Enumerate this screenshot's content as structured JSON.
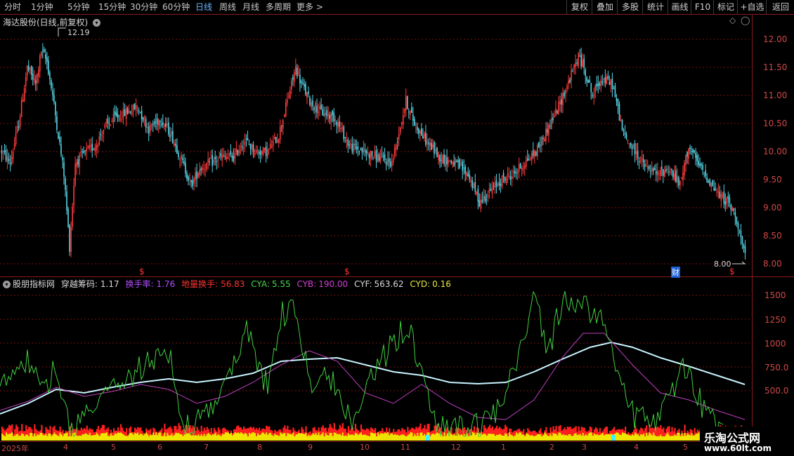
{
  "topbar": {
    "tabs": [
      {
        "label": "分时",
        "active": false
      },
      {
        "label": "1分钟",
        "active": false
      },
      {
        "label": "5分钟",
        "active": false
      },
      {
        "label": "15分钟",
        "active": false
      },
      {
        "label": "30分钟",
        "active": false
      },
      {
        "label": "60分钟",
        "active": false
      },
      {
        "label": "日线",
        "active": true
      },
      {
        "label": "周线",
        "active": false
      },
      {
        "label": "月线",
        "active": false
      },
      {
        "label": "多周期",
        "active": false
      },
      {
        "label": "更多 >",
        "active": false
      }
    ],
    "right_buttons": [
      "复权",
      "叠加",
      "多股",
      "统计",
      "画线",
      "F10",
      "标记",
      "+自选",
      "返回"
    ]
  },
  "main_chart": {
    "title": "海达股份(日线,前复权)",
    "y_ticks": [
      "12.00",
      "11.50",
      "11.00",
      "10.50",
      "10.00",
      "9.50",
      "9.00",
      "8.50",
      "8.00"
    ],
    "high_label": "12.19",
    "low_label": "8.00",
    "markers": [
      {
        "text": "$",
        "color": "#ff3030"
      },
      {
        "text": "$",
        "color": "#ff3030"
      },
      {
        "text": "财",
        "color": "#3d8bff"
      },
      {
        "text": "$",
        "color": "#ff3030"
      }
    ]
  },
  "indicator": {
    "name": "股朋指标网",
    "items": [
      {
        "label": "穿越筹码:",
        "value": "1.17",
        "color": "#d8d8d8"
      },
      {
        "label": "换手率:",
        "value": "1.76",
        "color": "#b04dff"
      },
      {
        "label": "地量换手:",
        "value": "56.83",
        "color": "#ff3030"
      },
      {
        "label": "CYA:",
        "value": "5.55",
        "color": "#4fd24f"
      },
      {
        "label": "CYB:",
        "value": "190.00",
        "color": "#d040d0"
      },
      {
        "label": "CYF:",
        "value": "563.62",
        "color": "#d8d8d8"
      },
      {
        "label": "CYD:",
        "value": "0.16",
        "color": "#e8e840"
      }
    ],
    "y_ticks": [
      "1500",
      "1250",
      "1000",
      "750.0",
      "500.0"
    ]
  },
  "x_axis": [
    "2025年",
    "4",
    "5",
    "6",
    "7",
    "8",
    "9",
    "10",
    "11",
    "12",
    "1",
    "2",
    "3",
    "4",
    "5"
  ],
  "logo": {
    "line1": "乐淘公式网",
    "line2": "www.60lt.com"
  },
  "colors": {
    "up": "#ff3b3b",
    "down": "#54d6e8",
    "grid": "#7a1010",
    "cyan_line": "#c8f4ff",
    "magenta_line": "#c040c0",
    "green_line": "#40d040"
  },
  "chart_data": {
    "type": "candlestick",
    "title": "海达股份(日线,前复权)",
    "ylim": [
      7.8,
      12.4
    ],
    "close_trend": [
      [
        0,
        10.0
      ],
      [
        6,
        9.8
      ],
      [
        12,
        10.5
      ],
      [
        18,
        11.5
      ],
      [
        24,
        11.2
      ],
      [
        28,
        11.8
      ],
      [
        32,
        11.6
      ],
      [
        36,
        11.0
      ],
      [
        44,
        9.6
      ],
      [
        48,
        8.3
      ],
      [
        52,
        9.8
      ],
      [
        60,
        10.0
      ],
      [
        66,
        10.1
      ],
      [
        72,
        10.4
      ],
      [
        80,
        10.6
      ],
      [
        88,
        10.7
      ],
      [
        96,
        10.8
      ],
      [
        104,
        10.4
      ],
      [
        112,
        10.6
      ],
      [
        120,
        10.3
      ],
      [
        128,
        9.8
      ],
      [
        134,
        9.4
      ],
      [
        140,
        9.7
      ],
      [
        148,
        9.8
      ],
      [
        156,
        9.9
      ],
      [
        164,
        9.9
      ],
      [
        172,
        10.2
      ],
      [
        180,
        10.0
      ],
      [
        188,
        10.0
      ],
      [
        196,
        10.3
      ],
      [
        202,
        10.9
      ],
      [
        208,
        11.5
      ],
      [
        212,
        11.2
      ],
      [
        218,
        10.9
      ],
      [
        226,
        10.7
      ],
      [
        236,
        10.6
      ],
      [
        246,
        10.1
      ],
      [
        256,
        10.0
      ],
      [
        266,
        9.9
      ],
      [
        276,
        9.8
      ],
      [
        286,
        10.9
      ],
      [
        292,
        10.5
      ],
      [
        300,
        10.2
      ],
      [
        310,
        9.9
      ],
      [
        320,
        9.8
      ],
      [
        330,
        9.6
      ],
      [
        338,
        9.1
      ],
      [
        346,
        9.3
      ],
      [
        354,
        9.5
      ],
      [
        362,
        9.6
      ],
      [
        370,
        9.8
      ],
      [
        378,
        10.0
      ],
      [
        386,
        10.4
      ],
      [
        394,
        10.8
      ],
      [
        402,
        11.3
      ],
      [
        408,
        11.7
      ],
      [
        412,
        11.5
      ],
      [
        418,
        11.0
      ],
      [
        424,
        11.3
      ],
      [
        432,
        11.2
      ],
      [
        440,
        10.3
      ],
      [
        448,
        10.0
      ],
      [
        456,
        9.7
      ],
      [
        464,
        9.6
      ],
      [
        472,
        9.7
      ],
      [
        480,
        9.4
      ],
      [
        486,
        10.1
      ],
      [
        492,
        9.8
      ],
      [
        500,
        9.5
      ],
      [
        508,
        9.2
      ],
      [
        514,
        9.1
      ],
      [
        520,
        8.8
      ],
      [
        526,
        8.1
      ]
    ]
  }
}
